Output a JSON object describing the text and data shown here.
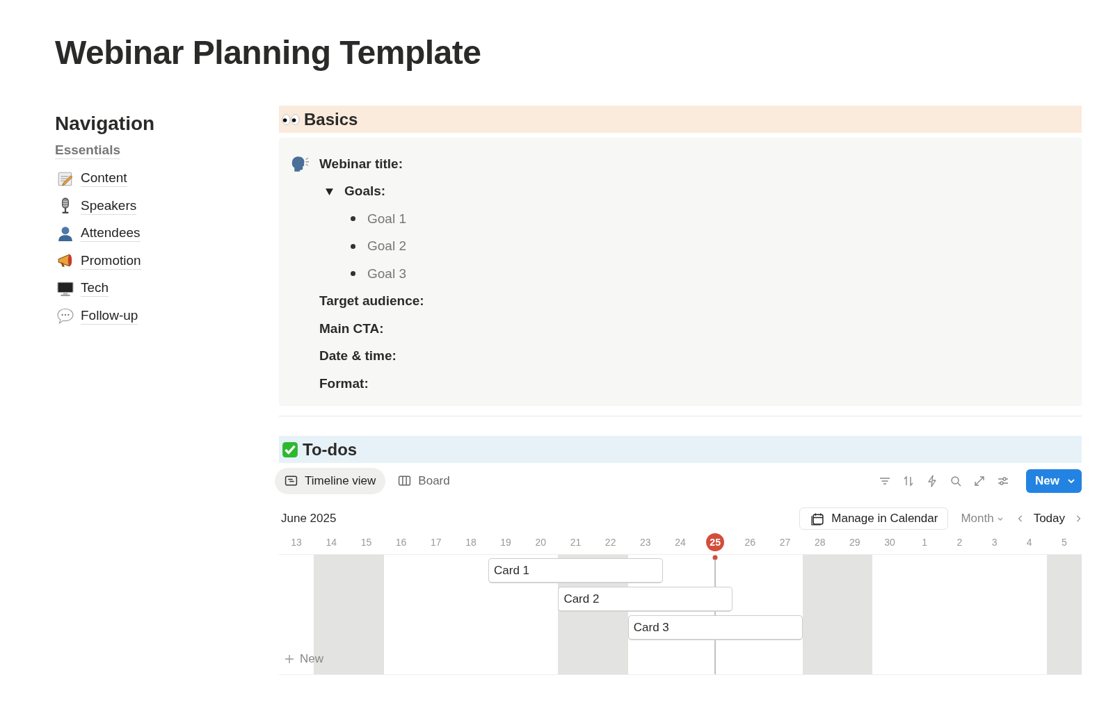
{
  "page_title": "Webinar Planning Template",
  "navigation": {
    "heading": "Navigation",
    "section": "Essentials",
    "items": [
      {
        "label": "Content"
      },
      {
        "label": "Speakers"
      },
      {
        "label": "Attendees"
      },
      {
        "label": "Promotion"
      },
      {
        "label": "Tech"
      },
      {
        "label": "Follow-up"
      }
    ]
  },
  "basics": {
    "heading": "Basics",
    "lines": [
      {
        "kind": "label",
        "text": "Webinar title:"
      },
      {
        "kind": "toggle",
        "text": "Goals:",
        "expanded": true,
        "children": [
          {
            "text": "Goal 1"
          },
          {
            "text": "Goal 2"
          },
          {
            "text": "Goal 3"
          }
        ]
      },
      {
        "kind": "label",
        "text": "Target audience:"
      },
      {
        "kind": "label",
        "text": "Main CTA:"
      },
      {
        "kind": "label",
        "text": "Date & time:"
      },
      {
        "kind": "label",
        "text": "Format:"
      }
    ]
  },
  "todos": {
    "heading": "To-dos",
    "views": [
      {
        "label": "Timeline view",
        "selected": true
      },
      {
        "label": "Board",
        "selected": false
      }
    ],
    "new_button": "New",
    "month": "June 2025",
    "manage_button": "Manage in Calendar",
    "scale": "Month",
    "today_button": "Today",
    "days": [
      {
        "label": "13",
        "weekend": false,
        "today": false
      },
      {
        "label": "14",
        "weekend": true,
        "today": false
      },
      {
        "label": "15",
        "weekend": true,
        "today": false
      },
      {
        "label": "16",
        "weekend": false,
        "today": false
      },
      {
        "label": "17",
        "weekend": false,
        "today": false
      },
      {
        "label": "18",
        "weekend": false,
        "today": false
      },
      {
        "label": "19",
        "weekend": false,
        "today": false
      },
      {
        "label": "20",
        "weekend": false,
        "today": false
      },
      {
        "label": "21",
        "weekend": true,
        "today": false
      },
      {
        "label": "22",
        "weekend": true,
        "today": false
      },
      {
        "label": "23",
        "weekend": false,
        "today": false
      },
      {
        "label": "24",
        "weekend": false,
        "today": false
      },
      {
        "label": "25",
        "weekend": false,
        "today": true
      },
      {
        "label": "26",
        "weekend": false,
        "today": false
      },
      {
        "label": "27",
        "weekend": false,
        "today": false
      },
      {
        "label": "28",
        "weekend": true,
        "today": false
      },
      {
        "label": "29",
        "weekend": true,
        "today": false
      },
      {
        "label": "30",
        "weekend": false,
        "today": false
      },
      {
        "label": "1",
        "weekend": false,
        "today": false
      },
      {
        "label": "2",
        "weekend": false,
        "today": false
      },
      {
        "label": "3",
        "weekend": false,
        "today": false
      },
      {
        "label": "4",
        "weekend": false,
        "today": false
      },
      {
        "label": "5",
        "weekend": true,
        "today": false
      }
    ],
    "cards": [
      {
        "title": "Card 1",
        "covers": [
          false,
          false,
          false,
          false,
          false,
          false,
          true,
          true,
          true,
          true,
          true,
          false,
          false,
          false,
          false,
          false,
          false,
          false,
          false,
          false,
          false,
          false,
          false
        ]
      },
      {
        "title": "Card 2",
        "covers": [
          false,
          false,
          false,
          false,
          false,
          false,
          false,
          false,
          true,
          true,
          true,
          true,
          true,
          false,
          false,
          false,
          false,
          false,
          false,
          false,
          false,
          false,
          false
        ]
      },
      {
        "title": "Card 3",
        "covers": [
          false,
          false,
          false,
          false,
          false,
          false,
          false,
          false,
          false,
          false,
          true,
          true,
          true,
          true,
          true,
          false,
          false,
          false,
          false,
          false,
          false,
          false,
          false
        ]
      }
    ],
    "add_label": "New"
  }
}
